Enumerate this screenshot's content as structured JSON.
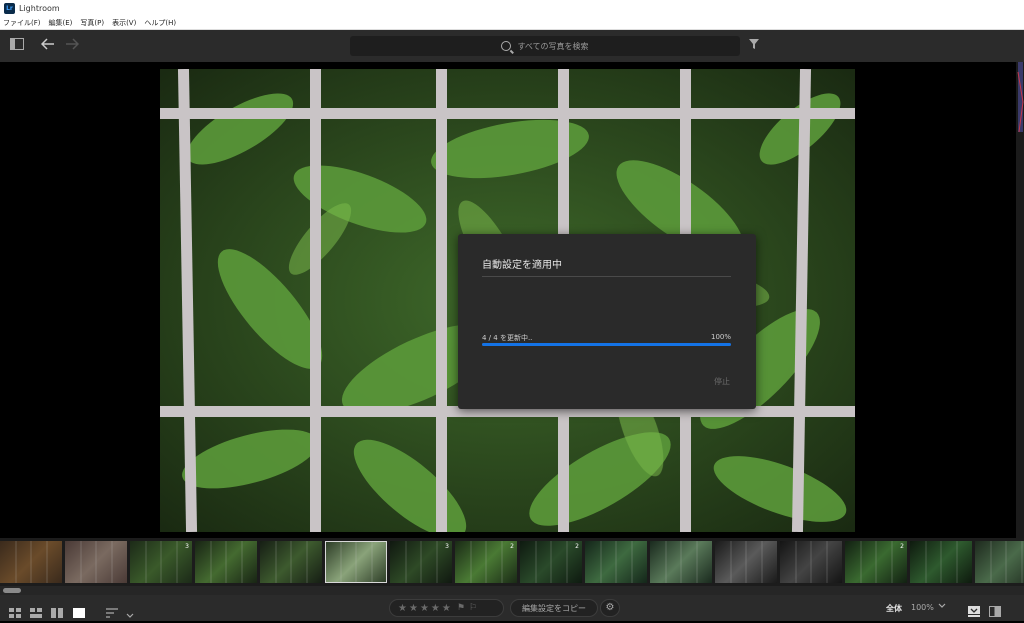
{
  "app": {
    "title": "Lightroom",
    "logo_text": "Lr"
  },
  "menu": [
    {
      "label": "ファイル(F)"
    },
    {
      "label": "編集(E)"
    },
    {
      "label": "写真(P)"
    },
    {
      "label": "表示(V)"
    },
    {
      "label": "ヘルプ(H)"
    }
  ],
  "toolbar": {
    "search_placeholder": "すべての写真を検索",
    "icons": [
      "panel-toggle-icon",
      "back-arrow-icon",
      "forward-arrow-icon",
      "filter-icon"
    ]
  },
  "dialog": {
    "title": "自動設定を適用中",
    "status": "4 / 4 を更新中..",
    "percent_label": "100%",
    "progress": 1.0,
    "stop_label": "停止"
  },
  "filmstrip": {
    "thumbnails": [
      {
        "badge": "",
        "selected": false
      },
      {
        "badge": "",
        "selected": false
      },
      {
        "badge": "3",
        "selected": false
      },
      {
        "badge": "",
        "selected": false
      },
      {
        "badge": "",
        "selected": false
      },
      {
        "badge": "",
        "selected": true
      },
      {
        "badge": "3",
        "selected": false
      },
      {
        "badge": "2",
        "selected": false
      },
      {
        "badge": "2",
        "selected": false
      },
      {
        "badge": "",
        "selected": false
      },
      {
        "badge": "",
        "selected": false
      },
      {
        "badge": "",
        "selected": false
      },
      {
        "badge": "",
        "selected": false
      },
      {
        "badge": "2",
        "selected": false
      },
      {
        "badge": "",
        "selected": false
      },
      {
        "badge": "",
        "selected": false
      },
      {
        "badge": "",
        "selected": false
      }
    ]
  },
  "bottombar": {
    "copy_button_label": "編集設定をコピー",
    "zoom_label": "全体",
    "zoom_value": "100%",
    "stars": [
      "★",
      "★",
      "★",
      "★",
      "★"
    ],
    "flags": [
      "⚑",
      "⚐"
    ]
  },
  "colors": {
    "accent": "#1473e6",
    "panel": "#2b2b2b",
    "dialog": "#2a2a2a"
  }
}
